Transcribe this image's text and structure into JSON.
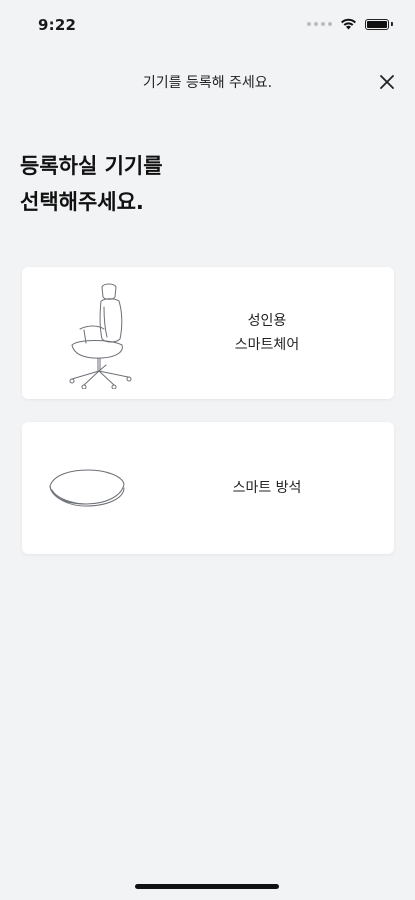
{
  "status_bar": {
    "time": "9:22",
    "icons": [
      "signal-dots-icon",
      "wifi-icon",
      "battery-icon"
    ]
  },
  "header": {
    "title": "기기를 등록해 주세요.",
    "close_icon": "close-icon"
  },
  "page_title": {
    "line1": "등록하실 기기를",
    "line2": "선택해주세요."
  },
  "devices": [
    {
      "label_line1": "성인용",
      "label_line2": "스마트체어",
      "icon": "office-chair-icon"
    },
    {
      "label_line1": "스마트 방석",
      "icon": "seat-cushion-icon"
    }
  ],
  "colors": {
    "background": "#f2f3f5",
    "card": "#ffffff",
    "text": "#1a1a1a"
  }
}
